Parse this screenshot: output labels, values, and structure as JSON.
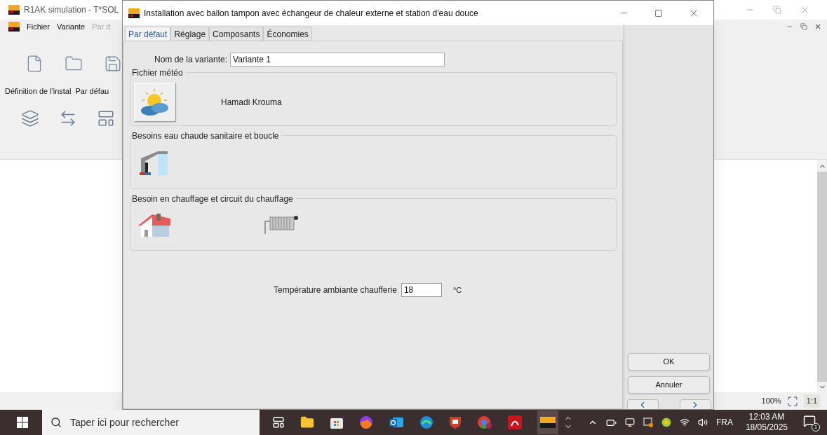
{
  "background_window": {
    "title": "R1AK simulation - T*SOL",
    "menu": [
      {
        "label": "Fichier",
        "disabled": false
      },
      {
        "label": "Variante",
        "disabled": false
      },
      {
        "label": "Par d",
        "disabled": true
      }
    ],
    "toolbar_labels": [
      "Définition de l'instal",
      "Par défau"
    ],
    "zoom_level": "100%",
    "zoom_actual": "1:1"
  },
  "dialog": {
    "title": "Installation avec ballon tampon avec échangeur de chaleur externe et station d'eau douce",
    "tabs": [
      {
        "label": "Par défaut",
        "selected": true
      },
      {
        "label": "Réglage",
        "selected": false
      },
      {
        "label": "Composants",
        "selected": false
      },
      {
        "label": "Économies",
        "selected": false
      }
    ],
    "variant_name": {
      "label": "Nom de la variante:",
      "value": "Variante 1"
    },
    "groups": [
      {
        "kind": "weather",
        "title": "Fichier météo",
        "text": "Hamadi Krouma"
      },
      {
        "kind": "hot_water",
        "title": "Besoins eau chaude sanitaire et boucle"
      },
      {
        "kind": "heating",
        "title": "Besoin en chauffage et circuit du chauffage"
      }
    ],
    "temperature": {
      "label": "Température ambiante chaufferie",
      "value": "18",
      "unit": "°C"
    },
    "buttons": [
      "OK",
      "Annuler"
    ]
  },
  "taskbar": {
    "search": {
      "placeholder": "Taper ici pour rechercher"
    },
    "language": "FRA",
    "time": "12:03 AM",
    "date": "18/05/2025",
    "notification_count": "1"
  }
}
